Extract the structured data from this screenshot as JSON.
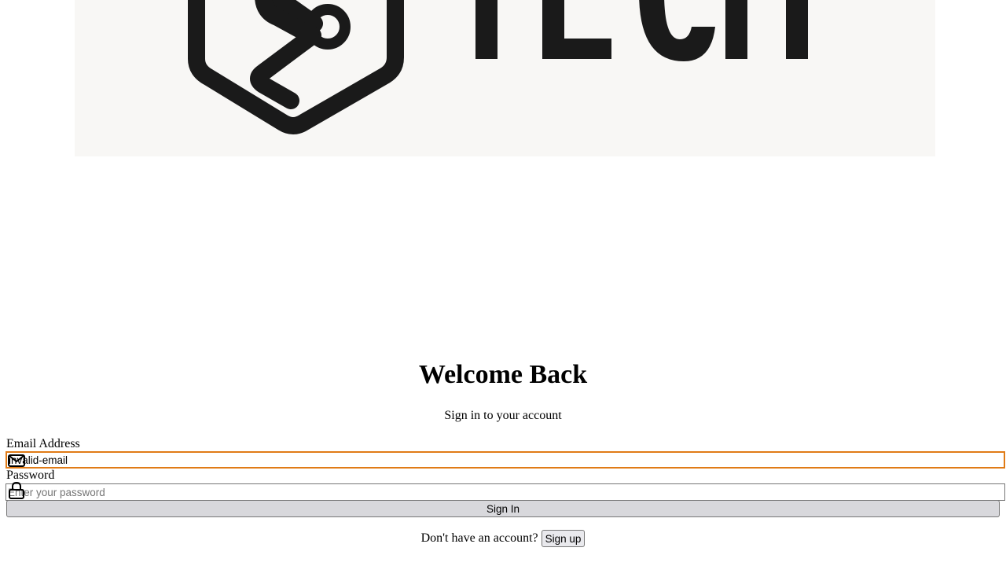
{
  "logo": {
    "wordmark": "TECH",
    "icon": "hexagon-circuit-logo",
    "background_color": "#f8f7f5",
    "ink_color": "#1a1a1a"
  },
  "header": {
    "title": "Welcome Back",
    "subtitle": "Sign in to your account"
  },
  "form": {
    "email": {
      "label": "Email Address",
      "value": "invalid-email",
      "icon": "envelope-icon",
      "border_color": "#e07b16"
    },
    "password": {
      "label": "Password",
      "value": "",
      "placeholder": "Enter your password",
      "icon": "lock-icon"
    },
    "submit_label": "Sign In"
  },
  "footer": {
    "prompt": "Don't have an account?",
    "signup_label": "Sign up"
  }
}
